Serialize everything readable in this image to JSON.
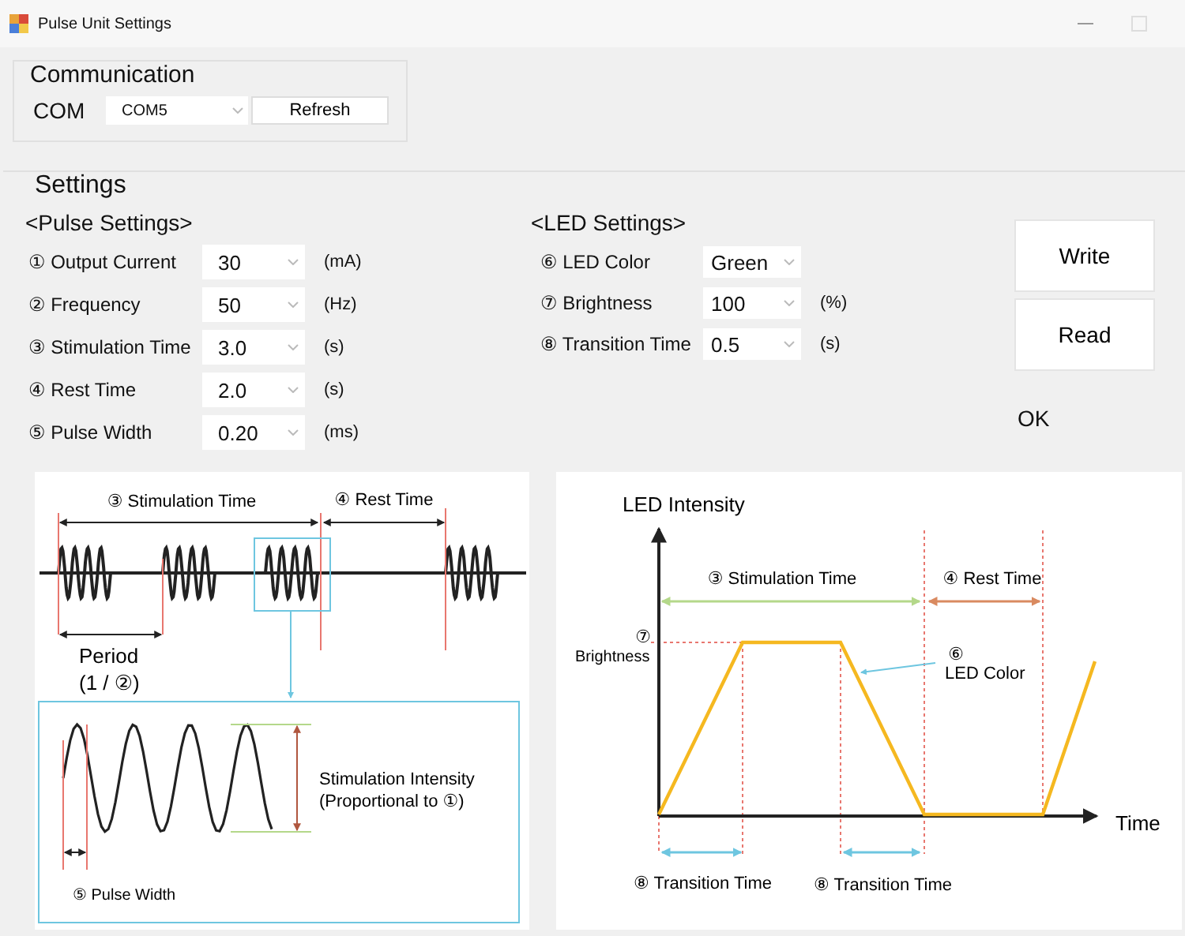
{
  "window": {
    "title": "Pulse Unit Settings"
  },
  "communication": {
    "title": "Communication",
    "com_label": "COM",
    "com_port": "COM5",
    "refresh_button": "Refresh"
  },
  "settings": {
    "title": "Settings",
    "pulse": {
      "heading": "<Pulse Settings>",
      "rows": [
        {
          "label": "① Output Current",
          "value": "30",
          "unit": "(mA)"
        },
        {
          "label": "② Frequency",
          "value": "50",
          "unit": "(Hz)"
        },
        {
          "label": "③ Stimulation Time",
          "value": "3.0",
          "unit": "(s)"
        },
        {
          "label": "④ Rest Time",
          "value": "2.0",
          "unit": "(s)"
        },
        {
          "label": "⑤ Pulse Width",
          "value": "0.20",
          "unit": "(ms)"
        }
      ]
    },
    "led": {
      "heading": "<LED Settings>",
      "rows": [
        {
          "label": "⑥ LED Color",
          "value": "Green"
        },
        {
          "label": "⑦ Brightness",
          "value": "100",
          "unit": "(%)"
        },
        {
          "label": "⑧ Transition Time",
          "value": "0.5",
          "unit": "(s)"
        }
      ]
    },
    "buttons": [
      "Write",
      "Read"
    ],
    "status": "OK"
  },
  "pulse_diagram": {
    "stimulation_time": "③ Stimulation Time",
    "rest_time": "④ Rest Time",
    "period": "Period",
    "period_formula": "(1 / ②)",
    "intensity": "Stimulation Intensity",
    "intensity_note": "(Proportional to ①)",
    "pulse_width": "⑤ Pulse Width"
  },
  "led_diagram": {
    "y_axis": "LED Intensity",
    "x_axis": "Time",
    "stimulation_time": "③ Stimulation Time",
    "rest_time": "④ Rest Time",
    "brightness_mark": "⑦",
    "brightness": "Brightness",
    "color_mark": "⑥",
    "color_label": "LED Color",
    "transition_times": [
      "⑧ Transition Time",
      "⑧ Transition Time"
    ]
  }
}
